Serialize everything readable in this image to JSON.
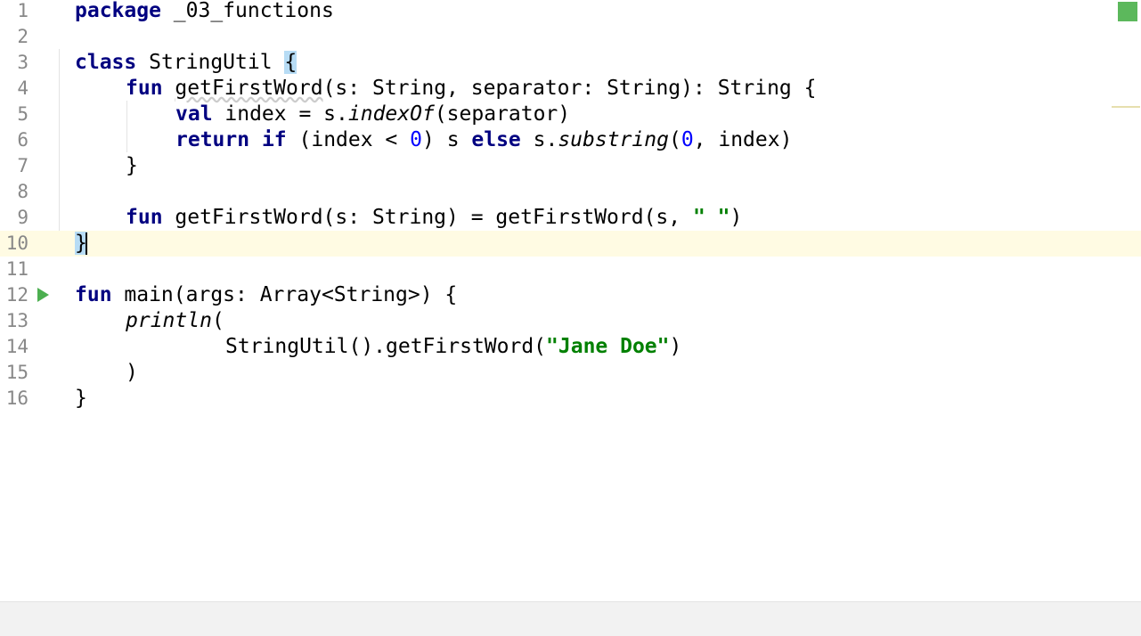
{
  "editor": {
    "lines": [
      {
        "num": "1"
      },
      {
        "num": "2"
      },
      {
        "num": "3"
      },
      {
        "num": "4"
      },
      {
        "num": "5"
      },
      {
        "num": "6"
      },
      {
        "num": "7"
      },
      {
        "num": "8"
      },
      {
        "num": "9"
      },
      {
        "num": "10"
      },
      {
        "num": "11"
      },
      {
        "num": "12"
      },
      {
        "num": "13"
      },
      {
        "num": "14"
      },
      {
        "num": "15"
      },
      {
        "num": "16"
      }
    ],
    "tokens": {
      "l1": [
        "package",
        " _03_functions"
      ],
      "l3": [
        "class",
        " StringUtil ",
        "{"
      ],
      "l4": [
        "fun",
        " ",
        "getFirstWord",
        "(s: String, separator: String): String {"
      ],
      "l5": [
        "val",
        " index = s.",
        "indexOf",
        "(separator)"
      ],
      "l6": [
        "return",
        " ",
        "if",
        " (index < ",
        "0",
        ") s ",
        "else",
        " s.",
        "substring",
        "(",
        "0",
        ", index)"
      ],
      "l7": [
        "}"
      ],
      "l9": [
        "fun",
        " getFirstWord(s: String) = getFirstWord(s, ",
        "\" \"",
        ")"
      ],
      "l10": [
        "}"
      ],
      "l12": [
        "fun",
        " main(args: Array<String>) {"
      ],
      "l13": [
        "println",
        "("
      ],
      "l14": [
        "StringUtil().getFirstWord(",
        "\"Jane Doe\"",
        ")"
      ],
      "l15": [
        ")"
      ],
      "l16": [
        "}"
      ]
    },
    "current_line": "10",
    "colors": {
      "keyword": "#000080",
      "string": "#008000",
      "number": "#0000ff",
      "current_line_bg": "#fffbe3",
      "inspection_ok": "#5cb85c",
      "run_icon": "#4caf50"
    },
    "icons": {
      "run": "run-gutter-icon",
      "status": "inspection-status-icon"
    }
  }
}
